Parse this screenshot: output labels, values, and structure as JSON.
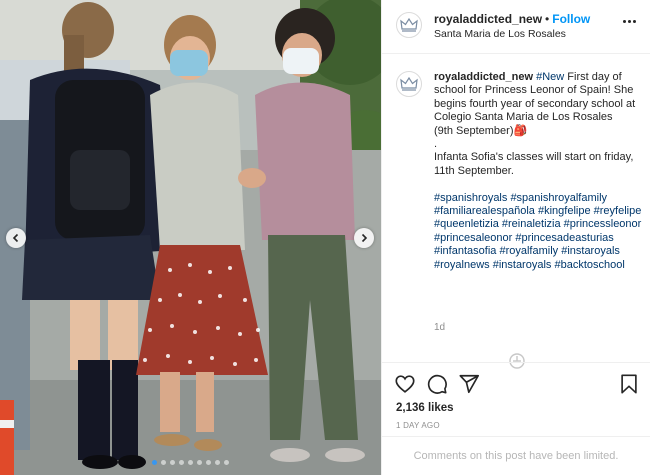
{
  "post": {
    "username": "royaladdicted_new",
    "separator": "•",
    "follow_label": "Follow",
    "location": "Santa Maria de Los Rosales",
    "caption_lines": [
      "#New First day of school for Princess Leonor of Spain! She begins fourth year of secondary school at Colegio Santa Maria de Los Rosales"
    ],
    "caption_first_tag": "#New",
    "caption_text": "First day of school for Princess Leonor of Spain! She begins fourth year of secondary school at Colegio Santa Maria de Los Rosales",
    "caption_date": "(9th September)",
    "caption_emoji": "🎒",
    "caption_dot": ".",
    "caption_second": "Infanta Sofia's classes will start on friday, 11th September.",
    "hashtags": [
      "#spanishroyals",
      "#spanishroyalfamily",
      "#familiarealespañola",
      "#kingfelipe",
      "#reyfelipe",
      "#queenletizia",
      "#reinaletizia",
      "#princessleonor",
      "#princesaleonor",
      "#princesadeasturias",
      "#infantasofia",
      "#royalfamily",
      "#instaroyals",
      "#royalnews",
      "#instaroyals",
      "#backtoschool"
    ],
    "time_ago": "1d",
    "likes": "2,136 likes",
    "date": "1 DAY AGO",
    "comments_limited": "Comments on this post have been limited."
  },
  "icons": {
    "avatar": "crown-avatar-icon",
    "more": "more-options-icon",
    "like": "heart-icon",
    "comment": "comment-icon",
    "share": "share-icon",
    "save": "bookmark-icon",
    "prev": "chevron-left-icon",
    "next": "chevron-right-icon",
    "loading": "loading-spinner-icon"
  },
  "colors": {
    "follow": "#0095f6",
    "hashtag": "#00376b",
    "muted": "#8e8e8e",
    "carousel_active": "#3897f0"
  },
  "carousel": {
    "count": 9,
    "active": 0
  }
}
